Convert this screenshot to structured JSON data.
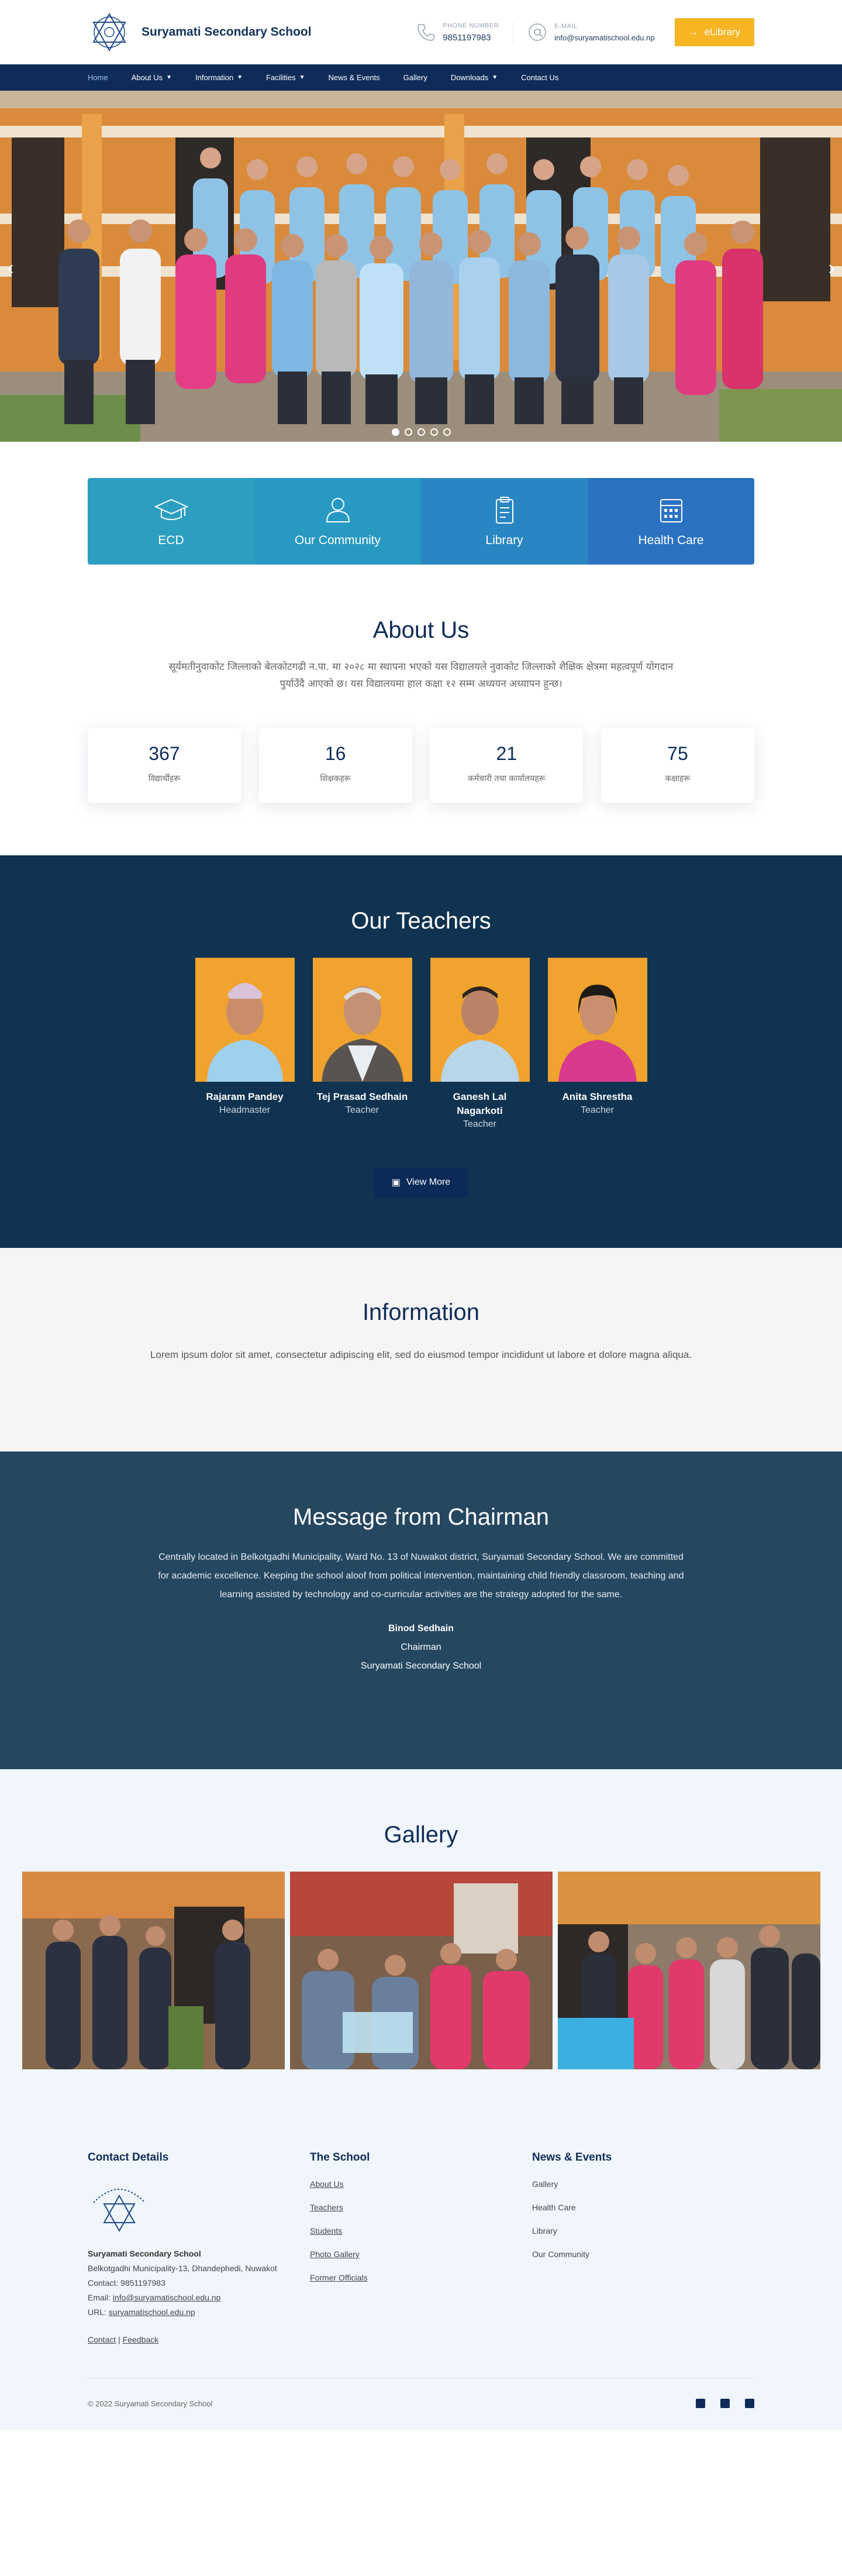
{
  "header": {
    "school_name": "Suryamati Secondary School",
    "phone_label": "PHONE NUMBER",
    "phone": "9851197983",
    "email_label": "E-MAIL",
    "email": "info@suryamatischool.edu.np",
    "elibrary": "eLibrary"
  },
  "nav": [
    "Home",
    "About Us",
    "Information",
    "Facilities",
    "News & Events",
    "Gallery",
    "Downloads",
    "Contact Us"
  ],
  "features": [
    {
      "label": "ECD",
      "icon": "graduation-cap-icon",
      "color": "#2c9fc0"
    },
    {
      "label": "Our Community",
      "icon": "community-icon",
      "color": "#2899c2"
    },
    {
      "label": "Library",
      "icon": "clipboard-icon",
      "color": "#2a86c2"
    },
    {
      "label": "Health Care",
      "icon": "calendar-icon",
      "color": "#2c72c2"
    }
  ],
  "about": {
    "title": "About Us",
    "text": "सूर्यमतीनुवाकोट जिल्लाको बेलकोटगढी न.पा. मा २०२८ मा स्थापना भएको यस विद्यालयले नुवाकोट जिल्लाको शैक्षिक क्षेत्रमा महत्वपूर्ण योगदान पुर्याउँदै आएको छ। यस विद्यालयमा हाल कक्षा १२ सम्म अध्ययन अध्यापन हुन्छ।",
    "stats": [
      {
        "value": "367",
        "label": "विद्यार्थीहरू"
      },
      {
        "value": "16",
        "label": "शिक्षकहरू"
      },
      {
        "value": "21",
        "label": "कर्मचारी तथा कार्यालयहरू"
      },
      {
        "value": "75",
        "label": "कक्षाहरू"
      }
    ]
  },
  "teachers": {
    "title": "Our Teachers",
    "list": [
      {
        "name": "Rajaram Pandey",
        "role": "Headmaster"
      },
      {
        "name": "Tej Prasad Sedhain",
        "role": "Teacher"
      },
      {
        "name": "Ganesh Lal Nagarkoti",
        "role": "Teacher"
      },
      {
        "name": "Anita Shrestha",
        "role": "Teacher"
      }
    ],
    "view_more": "View More"
  },
  "information": {
    "title": "Information",
    "text": "Lorem ipsum dolor sit amet, consectetur adipiscing elit, sed do eiusmod tempor incididunt ut labore et dolore magna aliqua."
  },
  "chairman": {
    "title": "Message from Chairman",
    "text": "Centrally located in Belkotgadhi Municipality, Ward No. 13 of Nuwakot district, Suryamati Secondary School. We are committed for academic excellence. Keeping the school aloof from political intervention, maintaining child friendly classroom, teaching and learning assisted by technology and co-curricular activities are the strategy adopted for the same.",
    "name": "Binod Sedhain",
    "position": "Chairman",
    "org": "Suryamati Secondary School"
  },
  "gallery": {
    "title": "Gallery"
  },
  "footer": {
    "contact_title": "Contact Details",
    "school": "Suryamati Secondary School",
    "address": "Belkotgadhi Municipality-13, Dhandephedi, Nuwakot",
    "contact": "Contact: 9851197983",
    "email_prefix": "Email: ",
    "email": "info@suryamatischool.edu.np",
    "url_prefix": "URL: ",
    "url": "suryamatischool.edu.np",
    "link_contact": "Contact",
    "link_sep": " | ",
    "link_feedback": "Feedback",
    "school_title": "The School",
    "school_links": [
      "About Us",
      "Teachers",
      "Students",
      "Photo Gallery",
      "Former Officials"
    ],
    "news_title": "News & Events",
    "news_links": [
      "Gallery",
      "Health Care",
      "Library",
      "Our Community"
    ],
    "copyright": "© 2022 Suryamati Secondary School"
  }
}
